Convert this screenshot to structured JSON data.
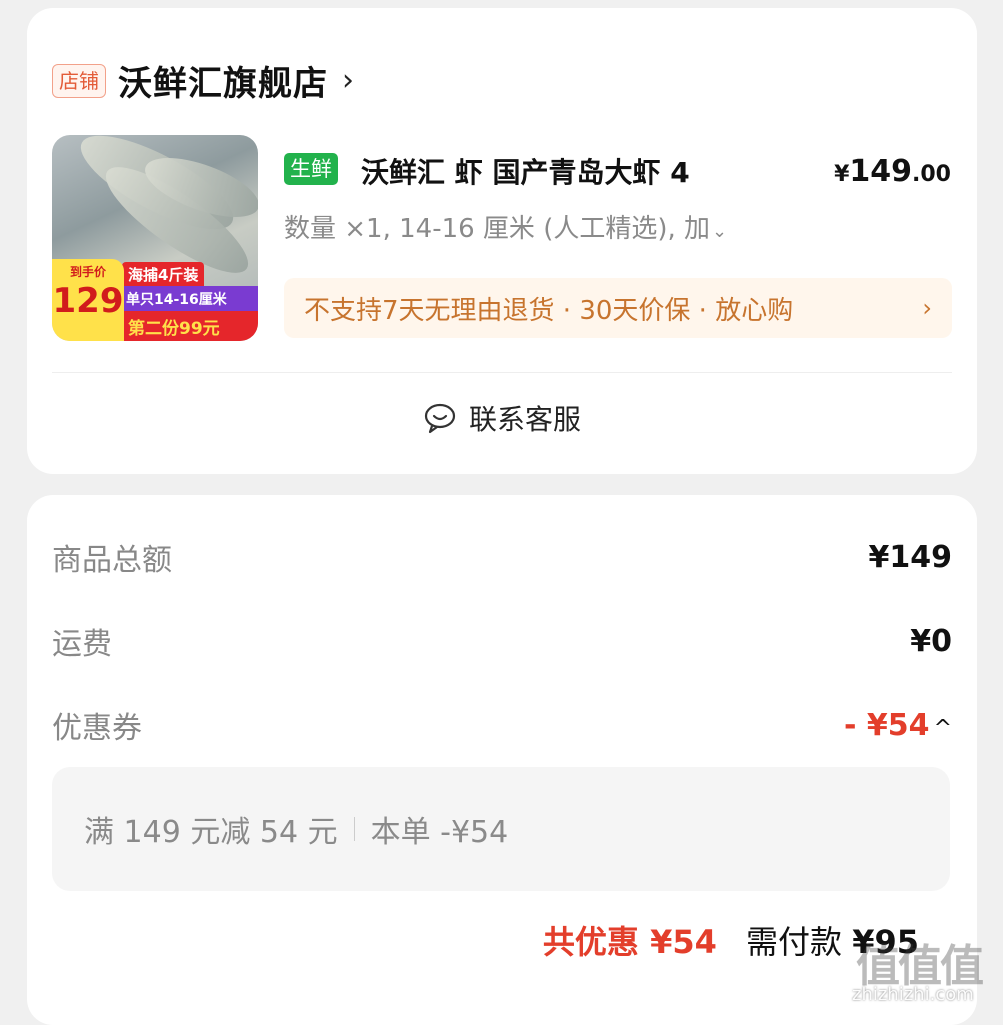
{
  "store": {
    "tag": "店铺",
    "name": "沃鲜汇旗舰店",
    "chevron": "›"
  },
  "product": {
    "image": {
      "promo_label": "到手价",
      "promo_price": "129",
      "promo_line1": "海捕4斤装",
      "promo_line2": "单只14-16厘米",
      "promo_line3": "第二份99元"
    },
    "badge": "生鲜",
    "title": "沃鲜汇 虾 国产青岛大虾 4",
    "price_currency": "¥",
    "price_int": "149",
    "price_dec": ".00",
    "spec": "数量 ×1, 14-16 厘米 (人工精选), 加",
    "spec_chevron": "⌄",
    "service": "不支持7天无理由退货 · 30天价保 · 放心购",
    "service_arrow": "›"
  },
  "contact": {
    "label": "联系客服",
    "icon": "chat-smile-icon"
  },
  "summary": {
    "subtotal_label": "商品总额",
    "subtotal_value": "¥149",
    "shipping_label": "运费",
    "shipping_value": "¥0",
    "coupon_label": "优惠券",
    "coupon_value": "- ¥54",
    "coupon_caret": "^",
    "coupon_detail_rule": "满 149 元减 54 元",
    "coupon_detail_order": "本单 -¥54",
    "total_discount": "共优惠 ¥54",
    "need_pay_label": "需付款",
    "need_pay_value": "¥95"
  },
  "watermark": {
    "logo": "值值值",
    "url": "zhizhizhi.com"
  },
  "colors": {
    "accent_red": "#e33e2b",
    "fresh_green": "#22b24c",
    "service_orange": "#c7742e"
  }
}
